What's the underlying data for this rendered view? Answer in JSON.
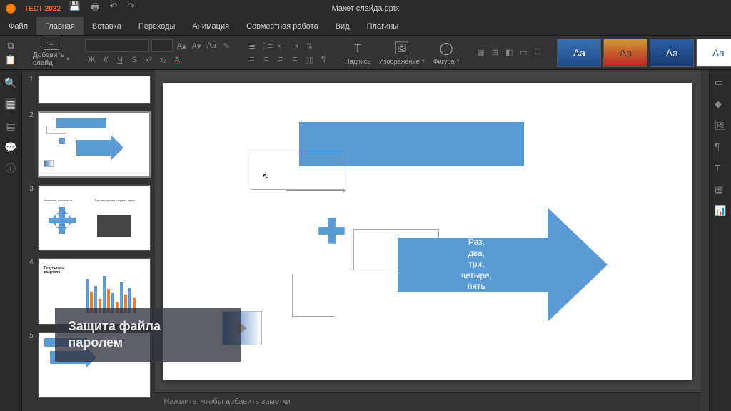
{
  "brand": "ТЕСТ 2022",
  "doc_title": "Макет слайда.pptx",
  "menu": {
    "file": "Файл",
    "home": "Главная",
    "insert": "Вставка",
    "transitions": "Переходы",
    "animation": "Анимация",
    "collab": "Совместная работа",
    "view": "Вид",
    "plugins": "Плагины"
  },
  "ribbon": {
    "add_slide": "Добавить слайд",
    "textbox": "Надпись",
    "image": "Изображение",
    "shape": "Фигура",
    "theme_aa": "Aa"
  },
  "slides": {
    "n1": "1",
    "n2": "2",
    "n3": "3",
    "n4": "4",
    "n5": "5"
  },
  "canvas": {
    "arrow_text_1": "Раз,",
    "arrow_text_2": "два,",
    "arrow_text_3": "три,",
    "arrow_text_4": "четыре,",
    "arrow_text_5": "пять"
  },
  "overlay": {
    "line1": "Защита файла",
    "line2": "паролем"
  },
  "notes_placeholder": "Нажмите, чтобы добавить заметки",
  "thumb3": {
    "t1": "Название активности",
    "t2": "Подтверждение ширины, фото"
  },
  "thumb4": {
    "title": "Результаты квартала"
  }
}
